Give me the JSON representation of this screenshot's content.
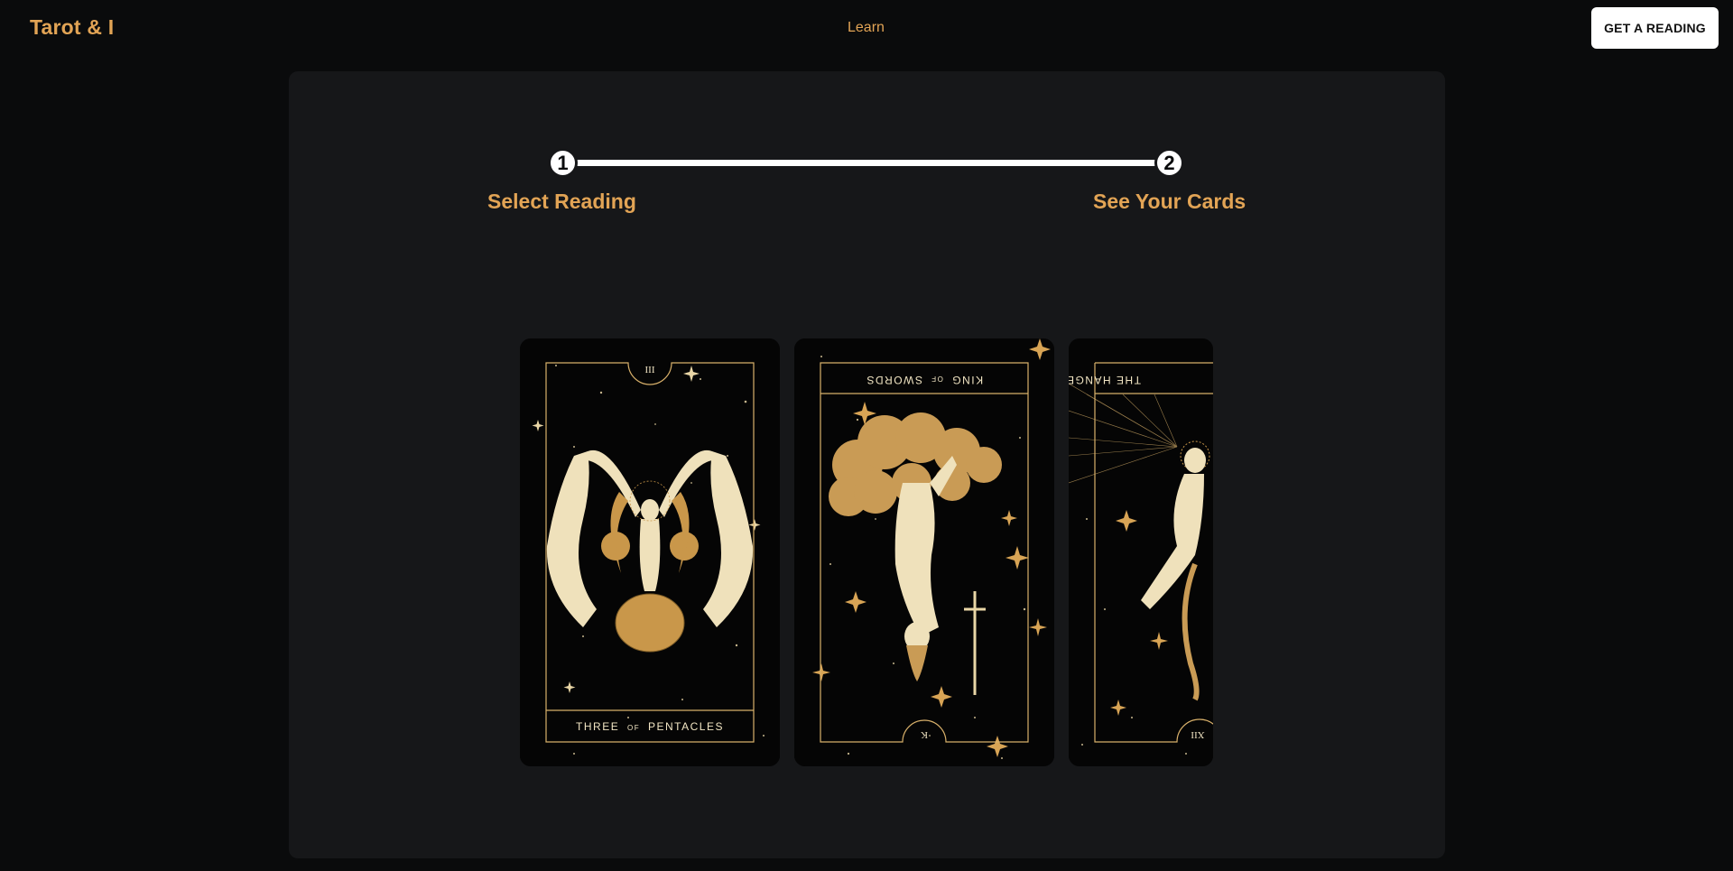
{
  "nav": {
    "brand": "Tarot & I",
    "learn_link": "Learn",
    "cta_label": "GET A READING"
  },
  "stepper": {
    "steps": [
      {
        "number": "1",
        "label": "Select Reading"
      },
      {
        "number": "2",
        "label": "See Your Cards"
      }
    ]
  },
  "cards": [
    {
      "numeral": "III",
      "title_main1": "THREE",
      "title_of": "OF",
      "title_main2": "PENTACLES",
      "orientation": "upright",
      "icon": "three-of-pentacles-icon"
    },
    {
      "numeral": "K",
      "title_main1": "KING",
      "title_of": "OF",
      "title_main2": "SWORDS",
      "orientation": "reversed",
      "icon": "king-of-swords-icon"
    },
    {
      "numeral": "XII",
      "title_main1": "THE HANGED ONE",
      "title_of": "",
      "title_main2": "",
      "orientation": "reversed",
      "icon": "hanged-one-icon"
    }
  ],
  "colors": {
    "accent": "#e2a455",
    "gold": "#d8b06a",
    "cream": "#f2e6c4",
    "panel": "#161719",
    "background": "#0a0b0c"
  }
}
